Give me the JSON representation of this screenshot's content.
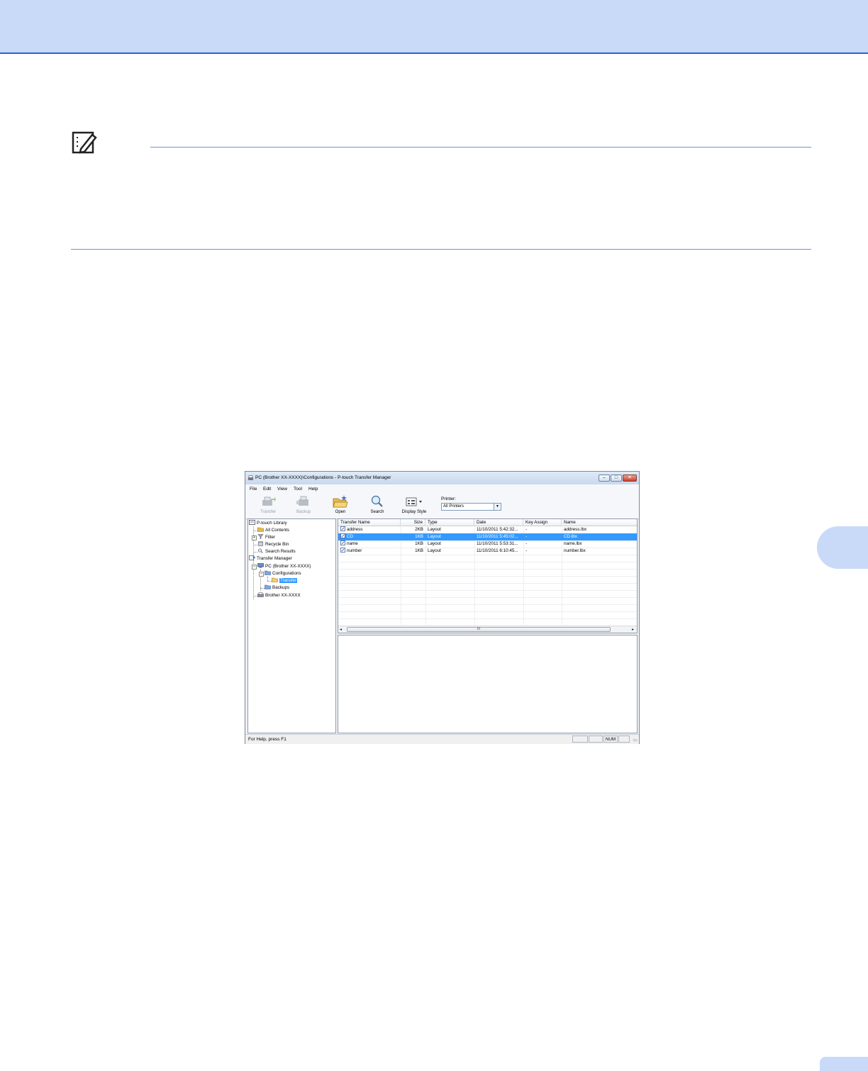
{
  "window": {
    "title": "PC (Brother XX-XXXX)\\Configurations - P-touch Transfer Manager",
    "minimize_label": "–",
    "maximize_label": "□",
    "close_label": "✕"
  },
  "menu": [
    "File",
    "Edit",
    "View",
    "Tool",
    "Help"
  ],
  "toolbar": {
    "transfer_label": "Transfer",
    "backup_label": "Backup",
    "open_label": "Open",
    "search_label": "Search",
    "display_style_label": "Display Style",
    "printer_label": "Printer:",
    "printer_value": "All Printers"
  },
  "tree": {
    "library": "P-touch Library",
    "all_contents": "All Contents",
    "filter": "Filter",
    "recycle_bin": "Recycle Bin",
    "search_results": "Search Results",
    "transfer_manager": "Transfer Manager",
    "pc": "PC (Brother XX-XXXX)",
    "configurations": "Configurations",
    "transfer": "Transfer",
    "backups": "Backups",
    "brother": "Brother XX-XXXX"
  },
  "list": {
    "columns": [
      "Transfer Name",
      "Size",
      "Type",
      "Date",
      "Key Assign",
      "Name"
    ],
    "rows": [
      {
        "transfer_name": "address",
        "size": "2KB",
        "type": "Layout",
        "date": "11/10/2011 5:42:32...",
        "key_assign": "-",
        "name": "address.lbx",
        "selected": false
      },
      {
        "transfer_name": "CD",
        "size": "1KB",
        "type": "Layout",
        "date": "11/10/2011 5:45:02...",
        "key_assign": "-",
        "name": "CD.lbx",
        "selected": true
      },
      {
        "transfer_name": "name",
        "size": "1KB",
        "type": "Layout",
        "date": "11/10/2011 5:53:31...",
        "key_assign": "-",
        "name": "name.lbx",
        "selected": false
      },
      {
        "transfer_name": "number",
        "size": "1KB",
        "type": "Layout",
        "date": "11/10/2011 6:10:45...",
        "key_assign": "-",
        "name": "number.lbx",
        "selected": false
      }
    ],
    "scroll_left": "◂",
    "scroll_right": "▸",
    "scroll_thumb": "III"
  },
  "status": {
    "help_text": "For Help, press F1",
    "num": "NUM"
  },
  "colors": {
    "header_band": "#c9daf8",
    "accent_line": "#2f5fd0",
    "selection": "#3399ff"
  }
}
